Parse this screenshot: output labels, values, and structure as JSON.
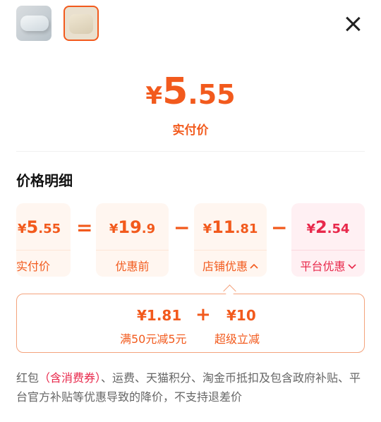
{
  "header": {
    "thumbnails": [
      {
        "name": "pillow-white",
        "selected": false
      },
      {
        "name": "pillow-beige",
        "selected": true
      }
    ],
    "close_icon": "close-icon"
  },
  "price": {
    "currency": "¥",
    "integer": "5",
    "decimal": ".55",
    "label": "实付价"
  },
  "breakdown": {
    "title": "价格明细",
    "items": [
      {
        "currency": "¥",
        "integer": "5",
        "decimal": ".55",
        "label": "实付价"
      },
      {
        "currency": "¥",
        "integer": "19",
        "decimal": ".9",
        "label": "优惠前"
      },
      {
        "currency": "¥",
        "integer": "11",
        "decimal": ".81",
        "label": "店铺优惠",
        "chevron": "^"
      },
      {
        "currency": "¥",
        "integer": "2",
        "decimal": ".54",
        "label": "平台优惠",
        "chevron": "v"
      }
    ],
    "operators": [
      "=",
      "−",
      "−"
    ]
  },
  "store_discount_detail": {
    "items": [
      {
        "value": "¥1.81",
        "label": "满50元减5元"
      },
      {
        "value": "¥10",
        "label": "超级立减"
      }
    ],
    "operator": "+"
  },
  "note": {
    "prefix": "红包",
    "highlight": "（含消费券）",
    "rest": "、运费、天猫积分、淘金币抵扣及包含政府补贴、平台官方补贴等优惠导致的降价，不支持退差价"
  },
  "colors": {
    "accent": "#f25a1d",
    "platform": "#e8284b"
  }
}
